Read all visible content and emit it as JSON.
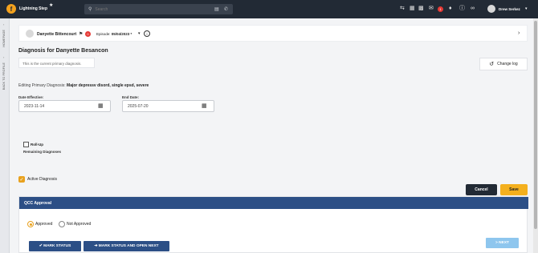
{
  "header": {
    "logo_letter": "f",
    "brand": "Lightning Step",
    "star": "★",
    "search_placeholder": "Search",
    "notification_count": "1",
    "user_name": "Drew Serkez"
  },
  "left_rail": {
    "homepage": "HOMEPAGE",
    "back_to_profile": "BACK TO PROFILE"
  },
  "patient_bar": {
    "name": "Danyette Bittencourt",
    "badge_count": "0",
    "episode_label": "Episode:",
    "episode_value": "05/04/2023 *"
  },
  "page": {
    "title": "Diagnosis for Danyette Besancon",
    "current_note": "This is the current primary diagnosis.",
    "change_log": "Change log",
    "editing_label": "Editing Primary Diagnosis:",
    "editing_value": "Major depressv disord, single epsd, severe"
  },
  "form": {
    "date_effective_label": "Date Effective:",
    "date_effective_value": "2023-11-14",
    "end_date_label": "End Date:",
    "end_date_value": "2025-07-20",
    "rollup_label": "Roll-Up",
    "remaining_label": "Remaining Diagnoses",
    "active_label": "Active Diagnosis",
    "active_checked": true,
    "cancel": "Cancel",
    "save": "Save"
  },
  "qcc": {
    "title": "QCC Approval",
    "approved": "Approved",
    "not_approved": "Not Approved",
    "selected": "Approved",
    "mark_status": "✔ MARK STATUS",
    "mark_status_next": "➔ MARK STATUS AND OPEN NEXT",
    "next": "> NEXT"
  },
  "colors": {
    "topbar": "#222a35",
    "accent": "#f4b01e",
    "qcc_header": "#2c4f86"
  }
}
